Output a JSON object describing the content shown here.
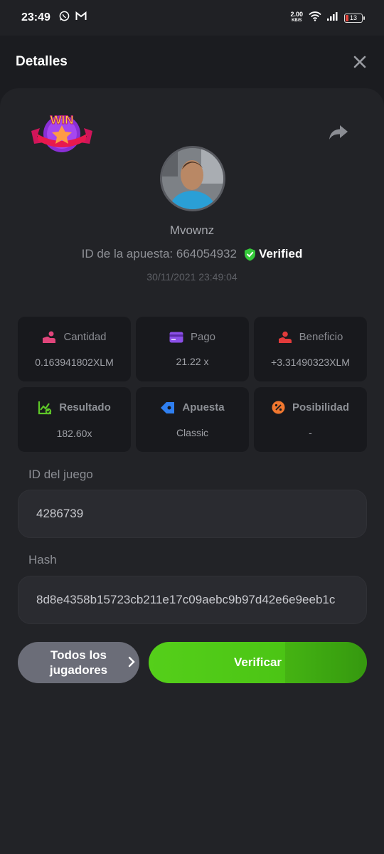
{
  "status_bar": {
    "time": "23:49",
    "net_speed_value": "2.00",
    "net_speed_unit": "KB/S",
    "battery": "13",
    "icons": [
      "whatsapp-icon",
      "gmail-icon",
      "wifi-icon",
      "signal-icon",
      "battery-icon"
    ]
  },
  "header": {
    "title": "Detalles",
    "close_icon": "close-icon"
  },
  "profile": {
    "badge_text": "WIN",
    "username": "Mvownz",
    "bet_id_label": "ID de la apuesta: 664054932",
    "verified_label": "Verified",
    "timestamp": "30/11/2021 23:49:04"
  },
  "stats": [
    {
      "label": "Cantidad",
      "value": "0.163941802XLM",
      "icon": "coins-hand-icon",
      "color": "#e0457b"
    },
    {
      "label": "Pago",
      "value": "21.22 x",
      "icon": "card-icon",
      "color": "#8b4fe8"
    },
    {
      "label": "Beneficio",
      "value": "+3.31490323XLM",
      "icon": "profit-hand-icon",
      "color": "#e23b3b"
    },
    {
      "label": "Resultado",
      "value": "182.60x",
      "icon": "chart-check-icon",
      "color": "#5ec728"
    },
    {
      "label": "Apuesta",
      "value": "Classic",
      "icon": "ticket-icon",
      "color": "#2f7ff0"
    },
    {
      "label": "Posibilidad",
      "value": "-",
      "icon": "percent-icon",
      "color": "#f0772f"
    }
  ],
  "game_id": {
    "label": "ID del juego",
    "value": "4286739"
  },
  "hash": {
    "label": "Hash",
    "value": "8d8e4358b15723cb211e17c09aebc9b97d42e6e9eeb1c"
  },
  "buttons": {
    "players": "Todos los jugadores",
    "verify": "Verificar"
  },
  "colors": {
    "background": "#1b1c20",
    "card": "#222327",
    "verify_green": "#4cc515",
    "verified_green": "#35c93a"
  }
}
